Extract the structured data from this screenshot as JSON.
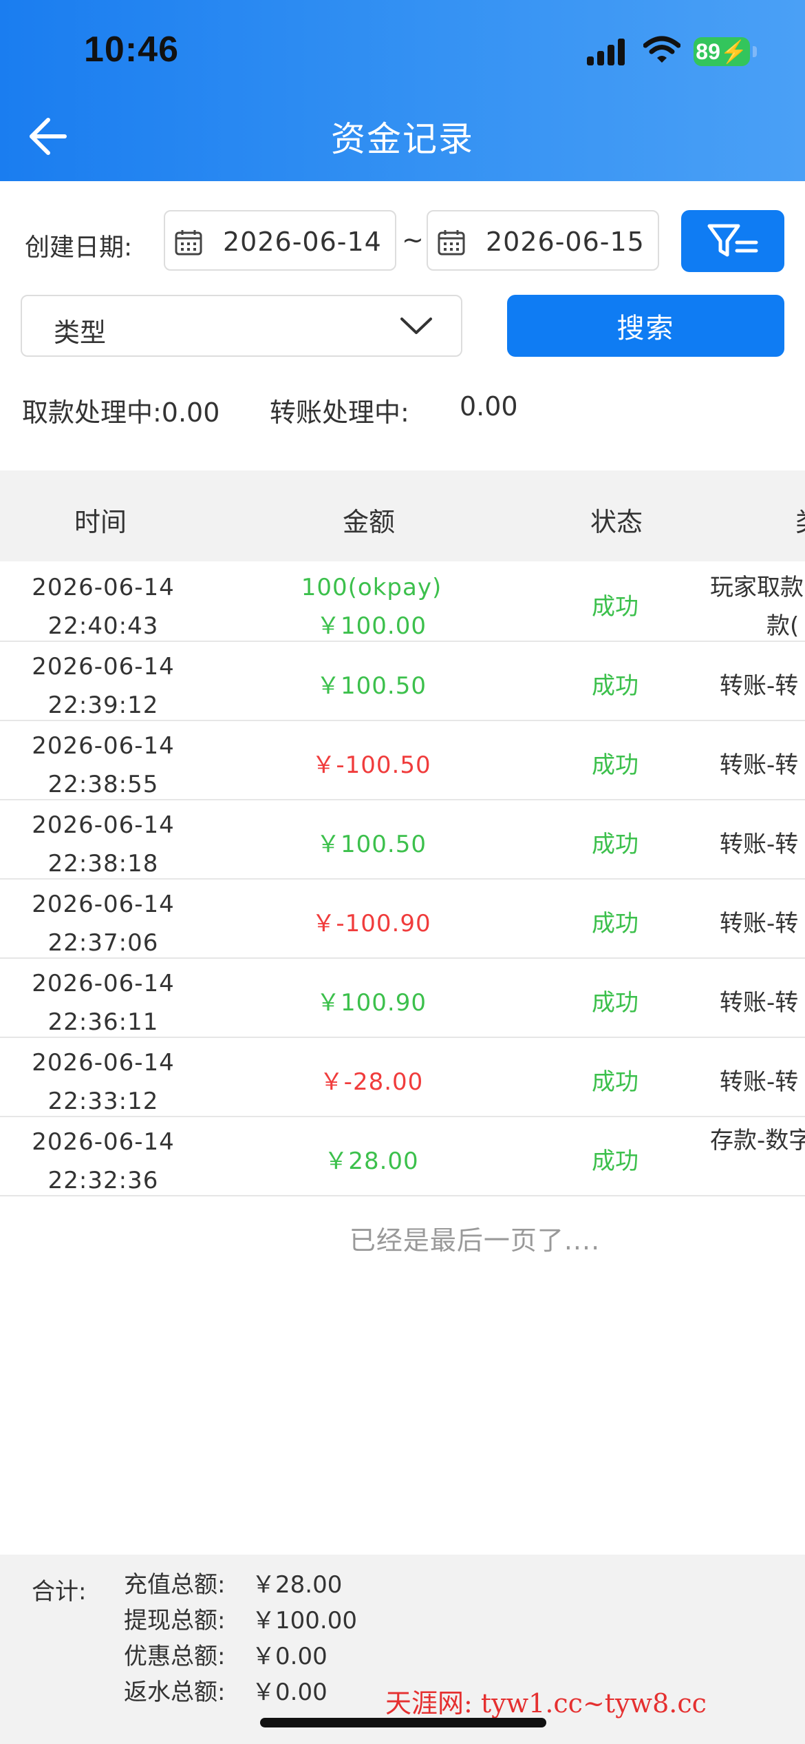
{
  "status_bar": {
    "time": "10:46",
    "battery": "89"
  },
  "header": {
    "title": "资金记录"
  },
  "filters": {
    "date_label": "创建日期:",
    "start_date": "2026-06-14",
    "separator": "~",
    "end_date": "2026-06-15",
    "type_placeholder": "类型",
    "search_label": "搜索"
  },
  "processing": {
    "withdraw": "取款处理中:0.00",
    "transfer_label": "转账处理中:",
    "transfer_value": "0.00"
  },
  "table": {
    "headers": [
      "时间",
      "金额",
      "状态",
      "类"
    ],
    "rows": [
      {
        "date": "2026-06-14",
        "time": "22:40:43",
        "amount_line1": "100(okpay)",
        "amount": "￥100.00",
        "sign": "pos",
        "status": "成功",
        "type_line1": "玩家取款",
        "type_line2": "款("
      },
      {
        "date": "2026-06-14",
        "time": "22:39:12",
        "amount": "￥100.50",
        "sign": "pos",
        "status": "成功",
        "type_line1": "转账-转"
      },
      {
        "date": "2026-06-14",
        "time": "22:38:55",
        "amount": "￥-100.50",
        "sign": "neg",
        "status": "成功",
        "type_line1": "转账-转"
      },
      {
        "date": "2026-06-14",
        "time": "22:38:18",
        "amount": "￥100.50",
        "sign": "pos",
        "status": "成功",
        "type_line1": "转账-转"
      },
      {
        "date": "2026-06-14",
        "time": "22:37:06",
        "amount": "￥-100.90",
        "sign": "neg",
        "status": "成功",
        "type_line1": "转账-转"
      },
      {
        "date": "2026-06-14",
        "time": "22:36:11",
        "amount": "￥100.90",
        "sign": "pos",
        "status": "成功",
        "type_line1": "转账-转"
      },
      {
        "date": "2026-06-14",
        "time": "22:33:12",
        "amount": "￥-28.00",
        "sign": "neg",
        "status": "成功",
        "type_line1": "转账-转"
      },
      {
        "date": "2026-06-14",
        "time": "22:32:36",
        "amount": "￥28.00",
        "sign": "pos",
        "status": "成功",
        "type_line1": "存款-数字"
      }
    ]
  },
  "end_message": "已经是最后一页了....",
  "summary": {
    "label": "合计:",
    "items": [
      {
        "label": "充值总额:",
        "value": "￥28.00"
      },
      {
        "label": "提现总额:",
        "value": "￥100.00"
      },
      {
        "label": "优惠总额:",
        "value": "￥0.00"
      },
      {
        "label": "返水总额:",
        "value": "￥0.00"
      }
    ]
  },
  "watermark": "天涯网: tyw1.cc~tyw8.cc",
  "colors": {
    "primary": "#0F7CF3",
    "success": "#3CC04C",
    "danger": "#F03C3C"
  }
}
